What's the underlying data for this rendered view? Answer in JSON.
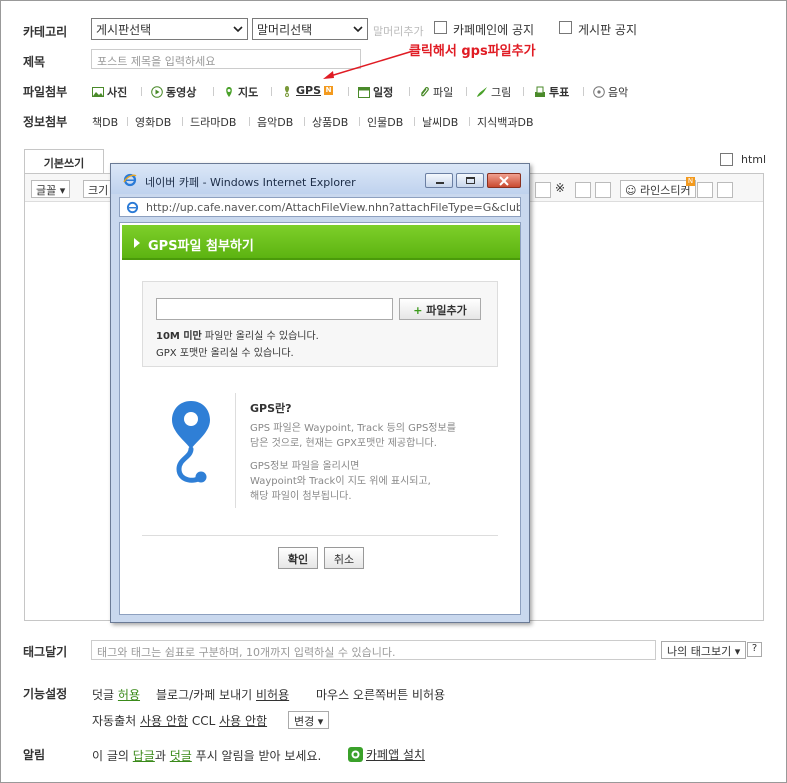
{
  "form": {
    "category_label": "카테고리",
    "board_select": "게시판선택",
    "head_select": "말머리선택",
    "head_add": "말머리추가",
    "cafe_main_notice": "카페메인에 공지",
    "board_notice": "게시판 공지",
    "title_label": "제목",
    "title_placeholder": "포스트 제목을 입력하세요",
    "attach_label": "파일첨부",
    "attach_items": [
      "사진",
      "동영상",
      "지도",
      "GPS",
      "일정",
      "파일",
      "그림",
      "투표",
      "음악"
    ],
    "gps_badge": "N",
    "info_label": "정보첨부",
    "info_items": [
      "책DB",
      "영화DB",
      "드라마DB",
      "음악DB",
      "상품DB",
      "인물DB",
      "날씨DB",
      "지식백과DB"
    ],
    "annotation": "클릭해서 gps파일추가"
  },
  "editor": {
    "tab_basic": "기본쓰기",
    "html_label": "html",
    "font_btn": "글꼴",
    "size_btn": "크기",
    "sticker_btn": "라인스티커",
    "sticker_badge": "N"
  },
  "popup": {
    "window_title": "네이버 카페 - Windows Internet Explorer",
    "address": "http://up.cafe.naver.com/AttachFileView.nhn?attachFileType=G&club",
    "header": "GPS파일 첨부하기",
    "add_file_btn": "파일추가",
    "note_limit_bold": "10M 미만",
    "note_limit_rest": " 파일만 올리실 수 있습니다.",
    "note_format": "GPX 포맷만 올리실 수 있습니다.",
    "gps_heading": "GPS란?",
    "gps_desc": [
      "GPS 파일은 Waypoint, Track 등의 GPS정보를",
      "담은 것으로, 현재는 GPX포맷만 제공합니다.",
      "",
      "GPS정보 파일을 올리시면",
      "Waypoint와 Track이 지도 위에 표시되고,",
      "해당 파일이 첨부됩니다."
    ],
    "confirm_btn": "확인",
    "cancel_btn": "취소"
  },
  "tags": {
    "label": "태그달기",
    "placeholder": "태그와 태그는 쉼표로 구분하며, 10개까지 입력하실 수 있습니다.",
    "my_tags_btn": "나의 태그보기",
    "help": "?"
  },
  "settings": {
    "label": "기능설정",
    "comment": "덧글",
    "comment_val": "허용",
    "blog_send": "블로그/카페 보내기",
    "blog_val": "비허용",
    "right_click": "마우스 오른쪽버튼 비허용",
    "auto_source": "자동출처",
    "auto_val": "사용 안함",
    "ccl": "CCL",
    "ccl_val": "사용 안함",
    "change_btn": "변경"
  },
  "alarm": {
    "label": "알림",
    "pre": "이 글의",
    "reply": "답글",
    "and": "과",
    "comment": "덧글",
    "post": "푸시 알림을 받아 보세요.",
    "app_link": "카페앱 설치"
  },
  "colors": {
    "green": "#5cb311",
    "annotation": "#e01c24",
    "link_green": "#3a8a1a",
    "pin_blue": "#2f7fd6"
  }
}
